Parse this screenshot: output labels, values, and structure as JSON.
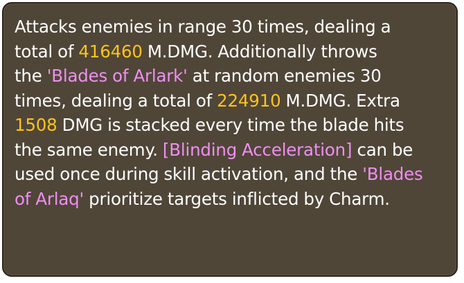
{
  "skill_description": {
    "segments": [
      {
        "text": "Attacks enemies in range 30 times, dealing a\ntotal of ",
        "style": "normal"
      },
      {
        "text": "416460",
        "style": "number"
      },
      {
        "text": " M.DMG. Additionally throws\nthe ",
        "style": "normal"
      },
      {
        "text": "'Blades of Arlark'",
        "style": "highlight"
      },
      {
        "text": " at random enemies 30\ntimes, dealing a total of ",
        "style": "normal"
      },
      {
        "text": "224910",
        "style": "number"
      },
      {
        "text": " M.DMG. Extra\n",
        "style": "normal"
      },
      {
        "text": "1508",
        "style": "number"
      },
      {
        "text": " DMG is stacked every time the blade hits\nthe same enemy. ",
        "style": "normal"
      },
      {
        "text": "[Blinding Acceleration]",
        "style": "highlight"
      },
      {
        "text": " can be\nused once during skill activation, and the ",
        "style": "normal"
      },
      {
        "text": "'Blades\nof Arlaq'",
        "style": "highlight"
      },
      {
        "text": " prioritize targets inflicted by Charm.",
        "style": "normal"
      }
    ]
  },
  "colors": {
    "background": "#4f4638",
    "border": "#2a241c",
    "text": "#ffffff",
    "number": "#ffc21c",
    "highlight": "#f08ef2"
  }
}
